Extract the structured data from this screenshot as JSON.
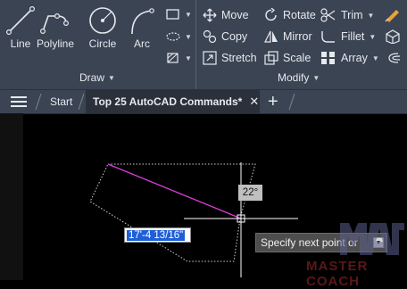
{
  "ribbon": {
    "draw": {
      "title": "Draw",
      "tools": [
        "Line",
        "Polyline",
        "Circle",
        "Arc"
      ]
    },
    "modify": {
      "title": "Modify",
      "tools": [
        "Move",
        "Rotate",
        "Trim",
        "Copy",
        "Mirror",
        "Fillet",
        "Stretch",
        "Scale",
        "Array"
      ]
    }
  },
  "tabs": {
    "start": "Start",
    "active": "Top 25 AutoCAD Commands*",
    "close_symbol": "✕",
    "new_symbol": "+"
  },
  "canvas": {
    "angle": "22°",
    "distance": "17'-4 13/16\"",
    "prompt": "Specify next point or",
    "watermark": "MASTER COACH"
  },
  "colors": {
    "ribbon_bg": "#3b4453",
    "canvas_bg": "#000000",
    "rubberband_line": "#e040e0",
    "accent_orange": "#e8a23a"
  }
}
